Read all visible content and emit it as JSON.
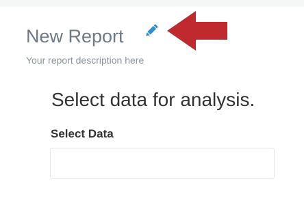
{
  "report": {
    "title": "New Report",
    "description": "Your report description here",
    "edit_icon": "pencil-icon"
  },
  "annotation": {
    "icon": "arrow-left-icon",
    "color": "#c0292d"
  },
  "analysis": {
    "heading": "Select data for analysis.",
    "field_label": "Select Data",
    "field_value": ""
  },
  "colors": {
    "title": "#6f7a86",
    "accent": "#2b8ed1",
    "text": "#333333"
  }
}
